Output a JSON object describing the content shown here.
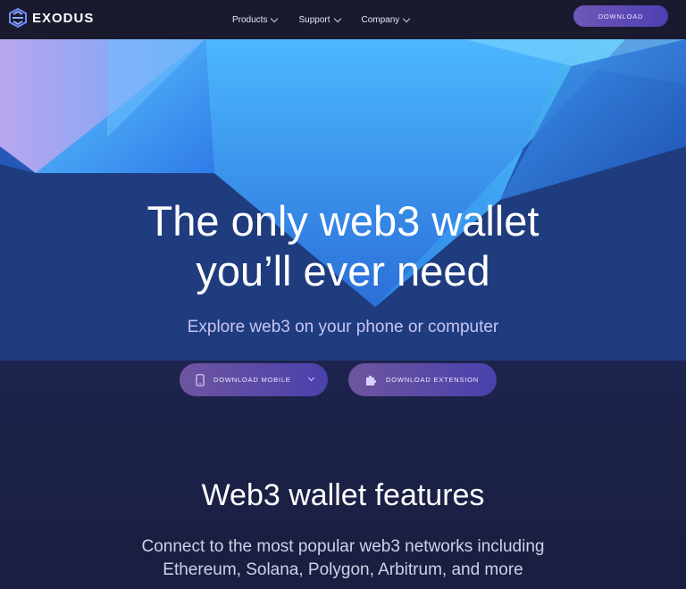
{
  "nav": {
    "brand": "EXODUS",
    "menu": [
      {
        "label": "Products"
      },
      {
        "label": "Support"
      },
      {
        "label": "Company"
      }
    ],
    "download_label": "DOWNLOAD"
  },
  "hero": {
    "title_line1": "The only web3 wallet",
    "title_line2": "you’ll ever need",
    "subtitle": "Explore web3 on your phone or computer",
    "buttons": {
      "mobile": {
        "label": "DOWNLOAD MOBILE",
        "icon": "phone-icon"
      },
      "extension": {
        "label": "DOWNLOAD EXTENSION",
        "icon": "puzzle-icon"
      }
    }
  },
  "features": {
    "title": "Web3 wallet features",
    "desc_line1": "Connect to the most popular web3 networks including",
    "desc_line2": "Ethereum, Solana, Polygon, Arbitrum, and more"
  },
  "colors": {
    "nav_bg": "#1a1a2e",
    "accent_start": "#6f57b5",
    "accent_end": "#4d3fb4",
    "hero_blue": "#3aa7f5",
    "page_bg": "#1b1f3f"
  }
}
